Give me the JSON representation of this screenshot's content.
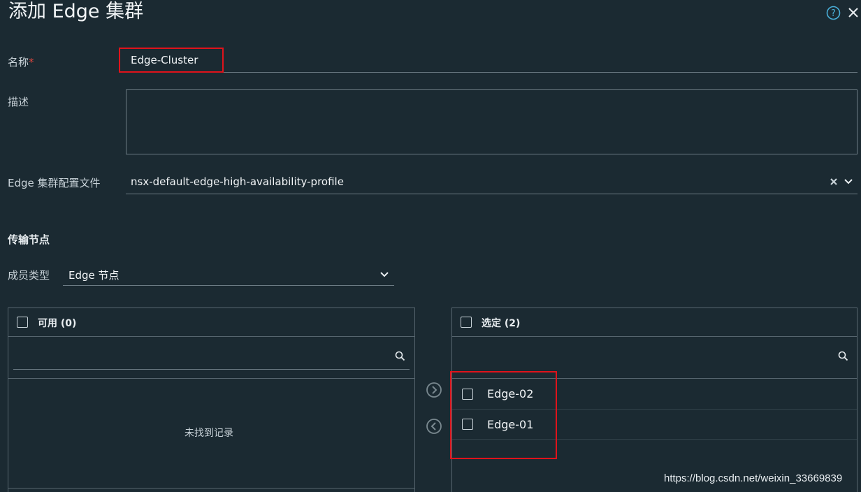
{
  "dialog": {
    "title": "添加 Edge 集群",
    "help_icon": "help-circle-icon",
    "close_icon": "close-icon"
  },
  "form": {
    "name_label": "名称",
    "required_mark": "*",
    "name_value": "Edge-Cluster",
    "description_label": "描述",
    "description_value": "",
    "profile_label": "Edge 集群配置文件",
    "profile_value": "nsx-default-edge-high-availability-profile"
  },
  "transport": {
    "section_title": "传输节点",
    "member_type_label": "成员类型",
    "member_type_value": "Edge 节点"
  },
  "available": {
    "header": "可用 (0)",
    "search_placeholder": "",
    "empty_text": "未找到记录"
  },
  "selected": {
    "header": "选定 (2)",
    "search_placeholder": "",
    "items": [
      "Edge-02",
      "Edge-01"
    ]
  },
  "watermark": "https://blog.csdn.net/weixin_33669839",
  "colors": {
    "background": "#1b2a32",
    "highlight_box": "#e0131b",
    "required": "#e0473f"
  }
}
